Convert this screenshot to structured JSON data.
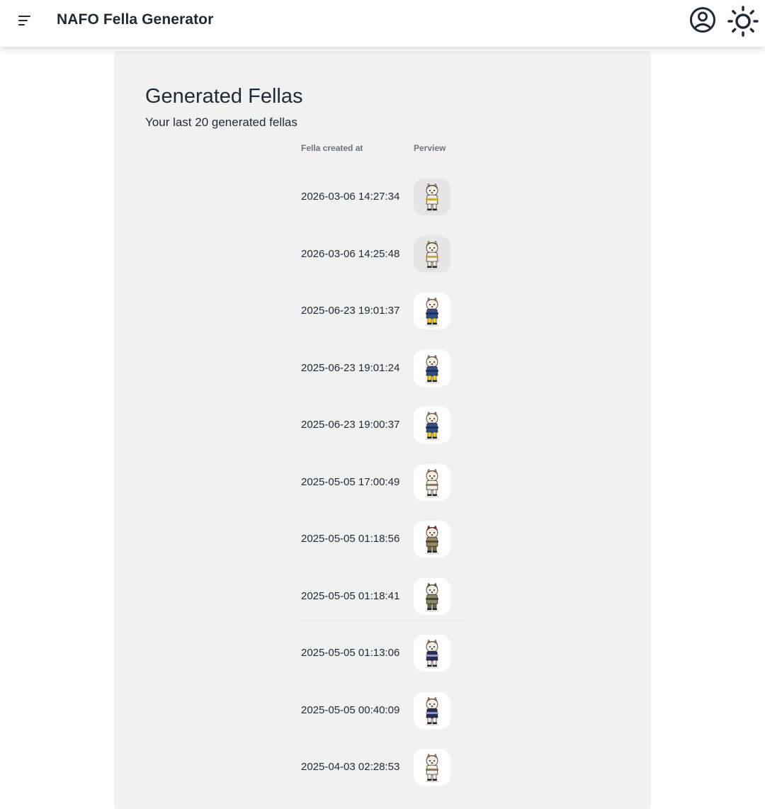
{
  "app": {
    "title": "NAFO Fella Generator"
  },
  "header": {
    "menu_icon": "menu-icon",
    "account_icon": "account-circle-icon",
    "theme_icon": "sun-icon"
  },
  "main": {
    "title": "Generated Fellas",
    "subtitle": "Your last 20 generated fellas",
    "table": {
      "columns": [
        "Fella created at",
        "Perview"
      ],
      "rows": [
        {
          "created_at": "2026-03-06 14:27:34",
          "preview": "fella-preview-yellow-helmet"
        },
        {
          "created_at": "2026-03-06 14:25:48",
          "preview": "fella-preview-yellow-helmet"
        },
        {
          "created_at": "2025-06-23 19:01:37",
          "preview": "fella-preview-blue-yellow"
        },
        {
          "created_at": "2025-06-23 19:01:24",
          "preview": "fella-preview-blue-yellow"
        },
        {
          "created_at": "2025-06-23 19:00:37",
          "preview": "fella-preview-blue-yellow"
        },
        {
          "created_at": "2025-05-05 17:00:49",
          "preview": "fella-preview-plain"
        },
        {
          "created_at": "2025-05-05 01:18:56",
          "preview": "fella-preview-beret-camo"
        },
        {
          "created_at": "2025-05-05 01:18:41",
          "preview": "fella-preview-green-camo"
        },
        {
          "created_at": "2025-05-05 01:13:06",
          "preview": "fella-preview-navy"
        },
        {
          "created_at": "2025-05-05 00:40:09",
          "preview": "fella-preview-navy"
        },
        {
          "created_at": "2025-04-03 02:28:53",
          "preview": "fella-preview-plain"
        }
      ]
    }
  },
  "colors": {
    "card_background": "#f1f1f1",
    "text": "#1f2937",
    "header_muted": "#6b7280"
  }
}
